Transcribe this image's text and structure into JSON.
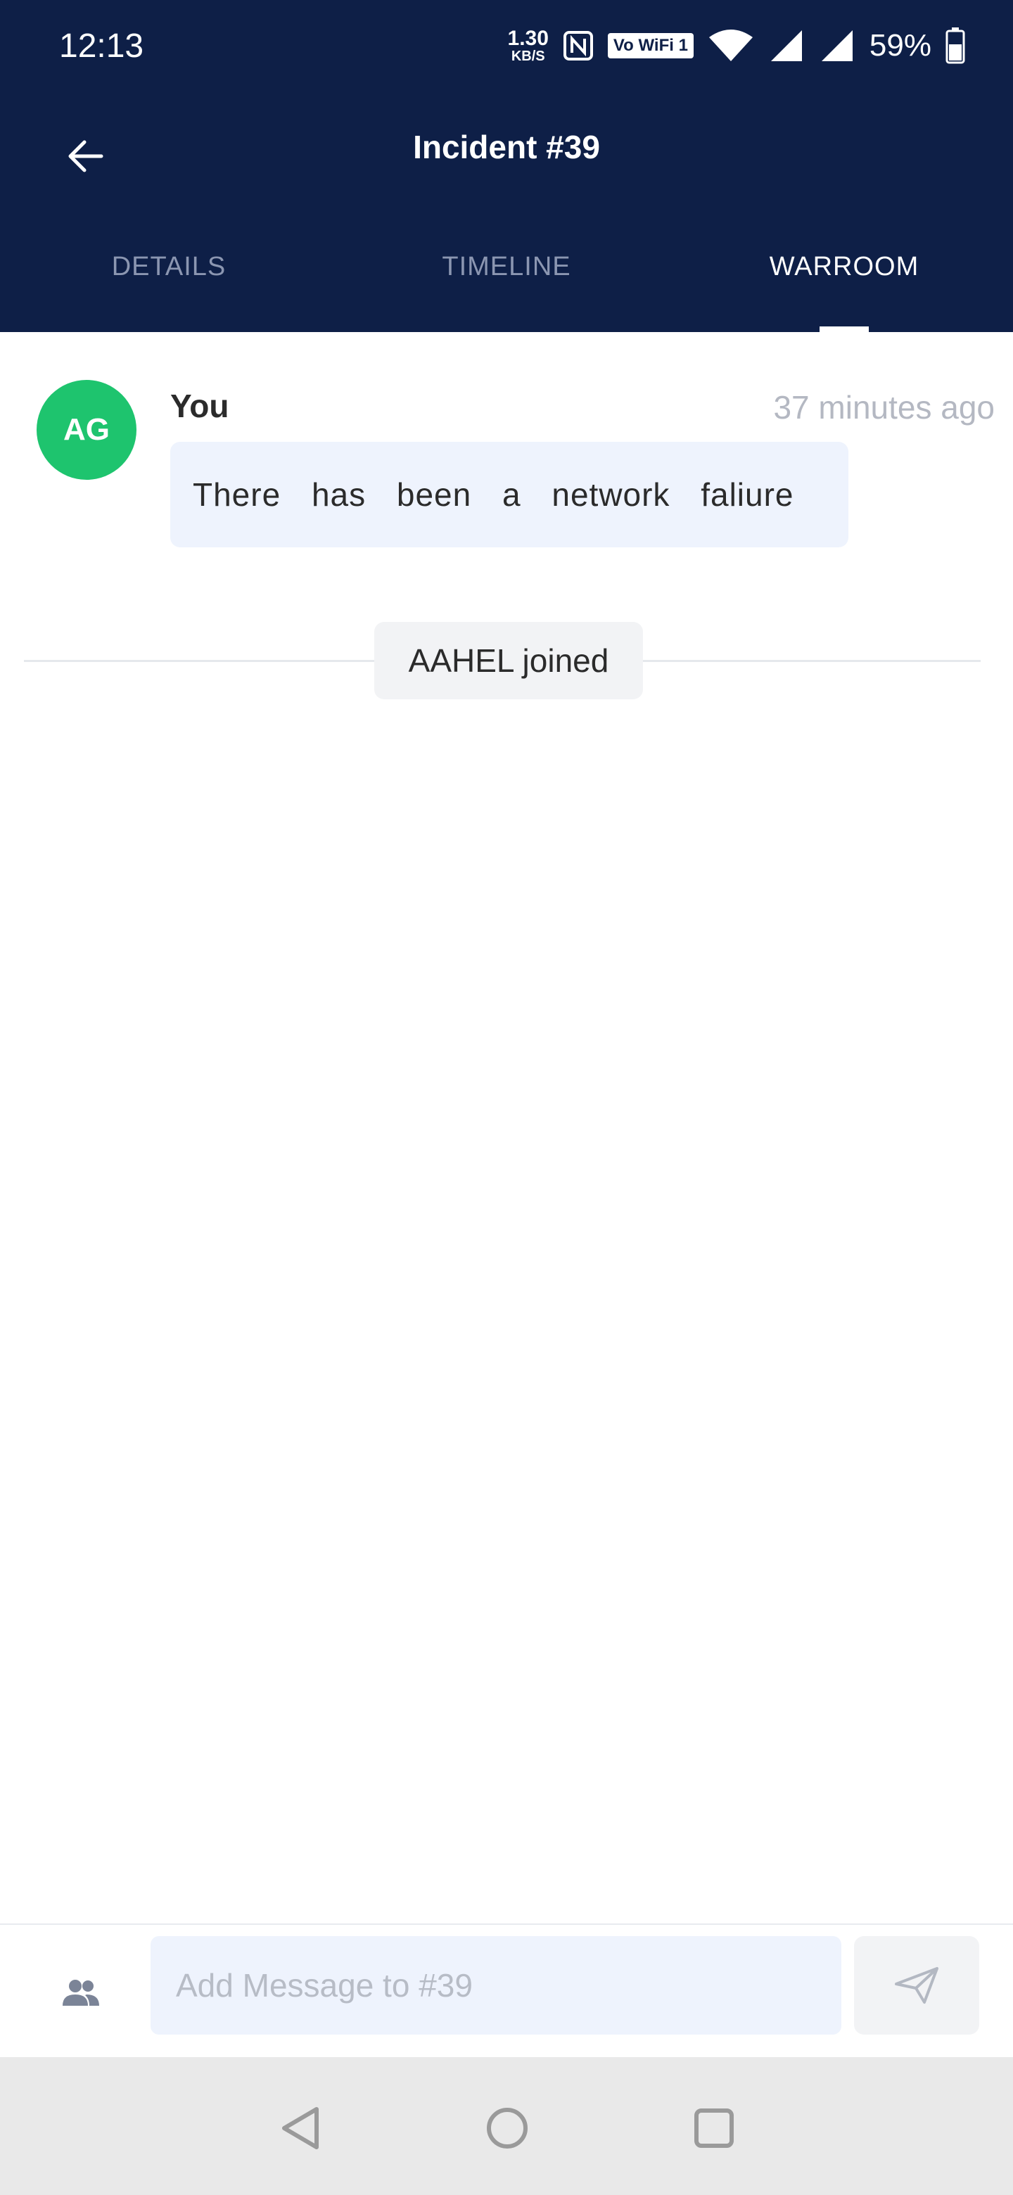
{
  "status_bar": {
    "time": "12:13",
    "speed_value": "1.30",
    "speed_unit": "KB/S",
    "volte_label": "Vo WiFi 1",
    "battery_percent": "59%"
  },
  "header": {
    "title": "Incident #39",
    "back_icon": "arrow-left-icon"
  },
  "tabs": [
    {
      "label": "DETAILS",
      "active": false
    },
    {
      "label": "TIMELINE",
      "active": false
    },
    {
      "label": "WARROOM",
      "active": true
    }
  ],
  "messages": [
    {
      "avatar_initials": "AG",
      "sender": "You",
      "time": "37 minutes ago",
      "text": "There has been a network faliure"
    }
  ],
  "events": [
    {
      "text": "AAHEL joined"
    }
  ],
  "composer": {
    "placeholder": "Add Message to #39",
    "value": "",
    "people_icon": "people-icon",
    "send_icon": "send-icon"
  },
  "colors": {
    "header_bg": "#0e1f47",
    "avatar_bg": "#1ec46e",
    "bubble_bg": "#eef3fd"
  }
}
